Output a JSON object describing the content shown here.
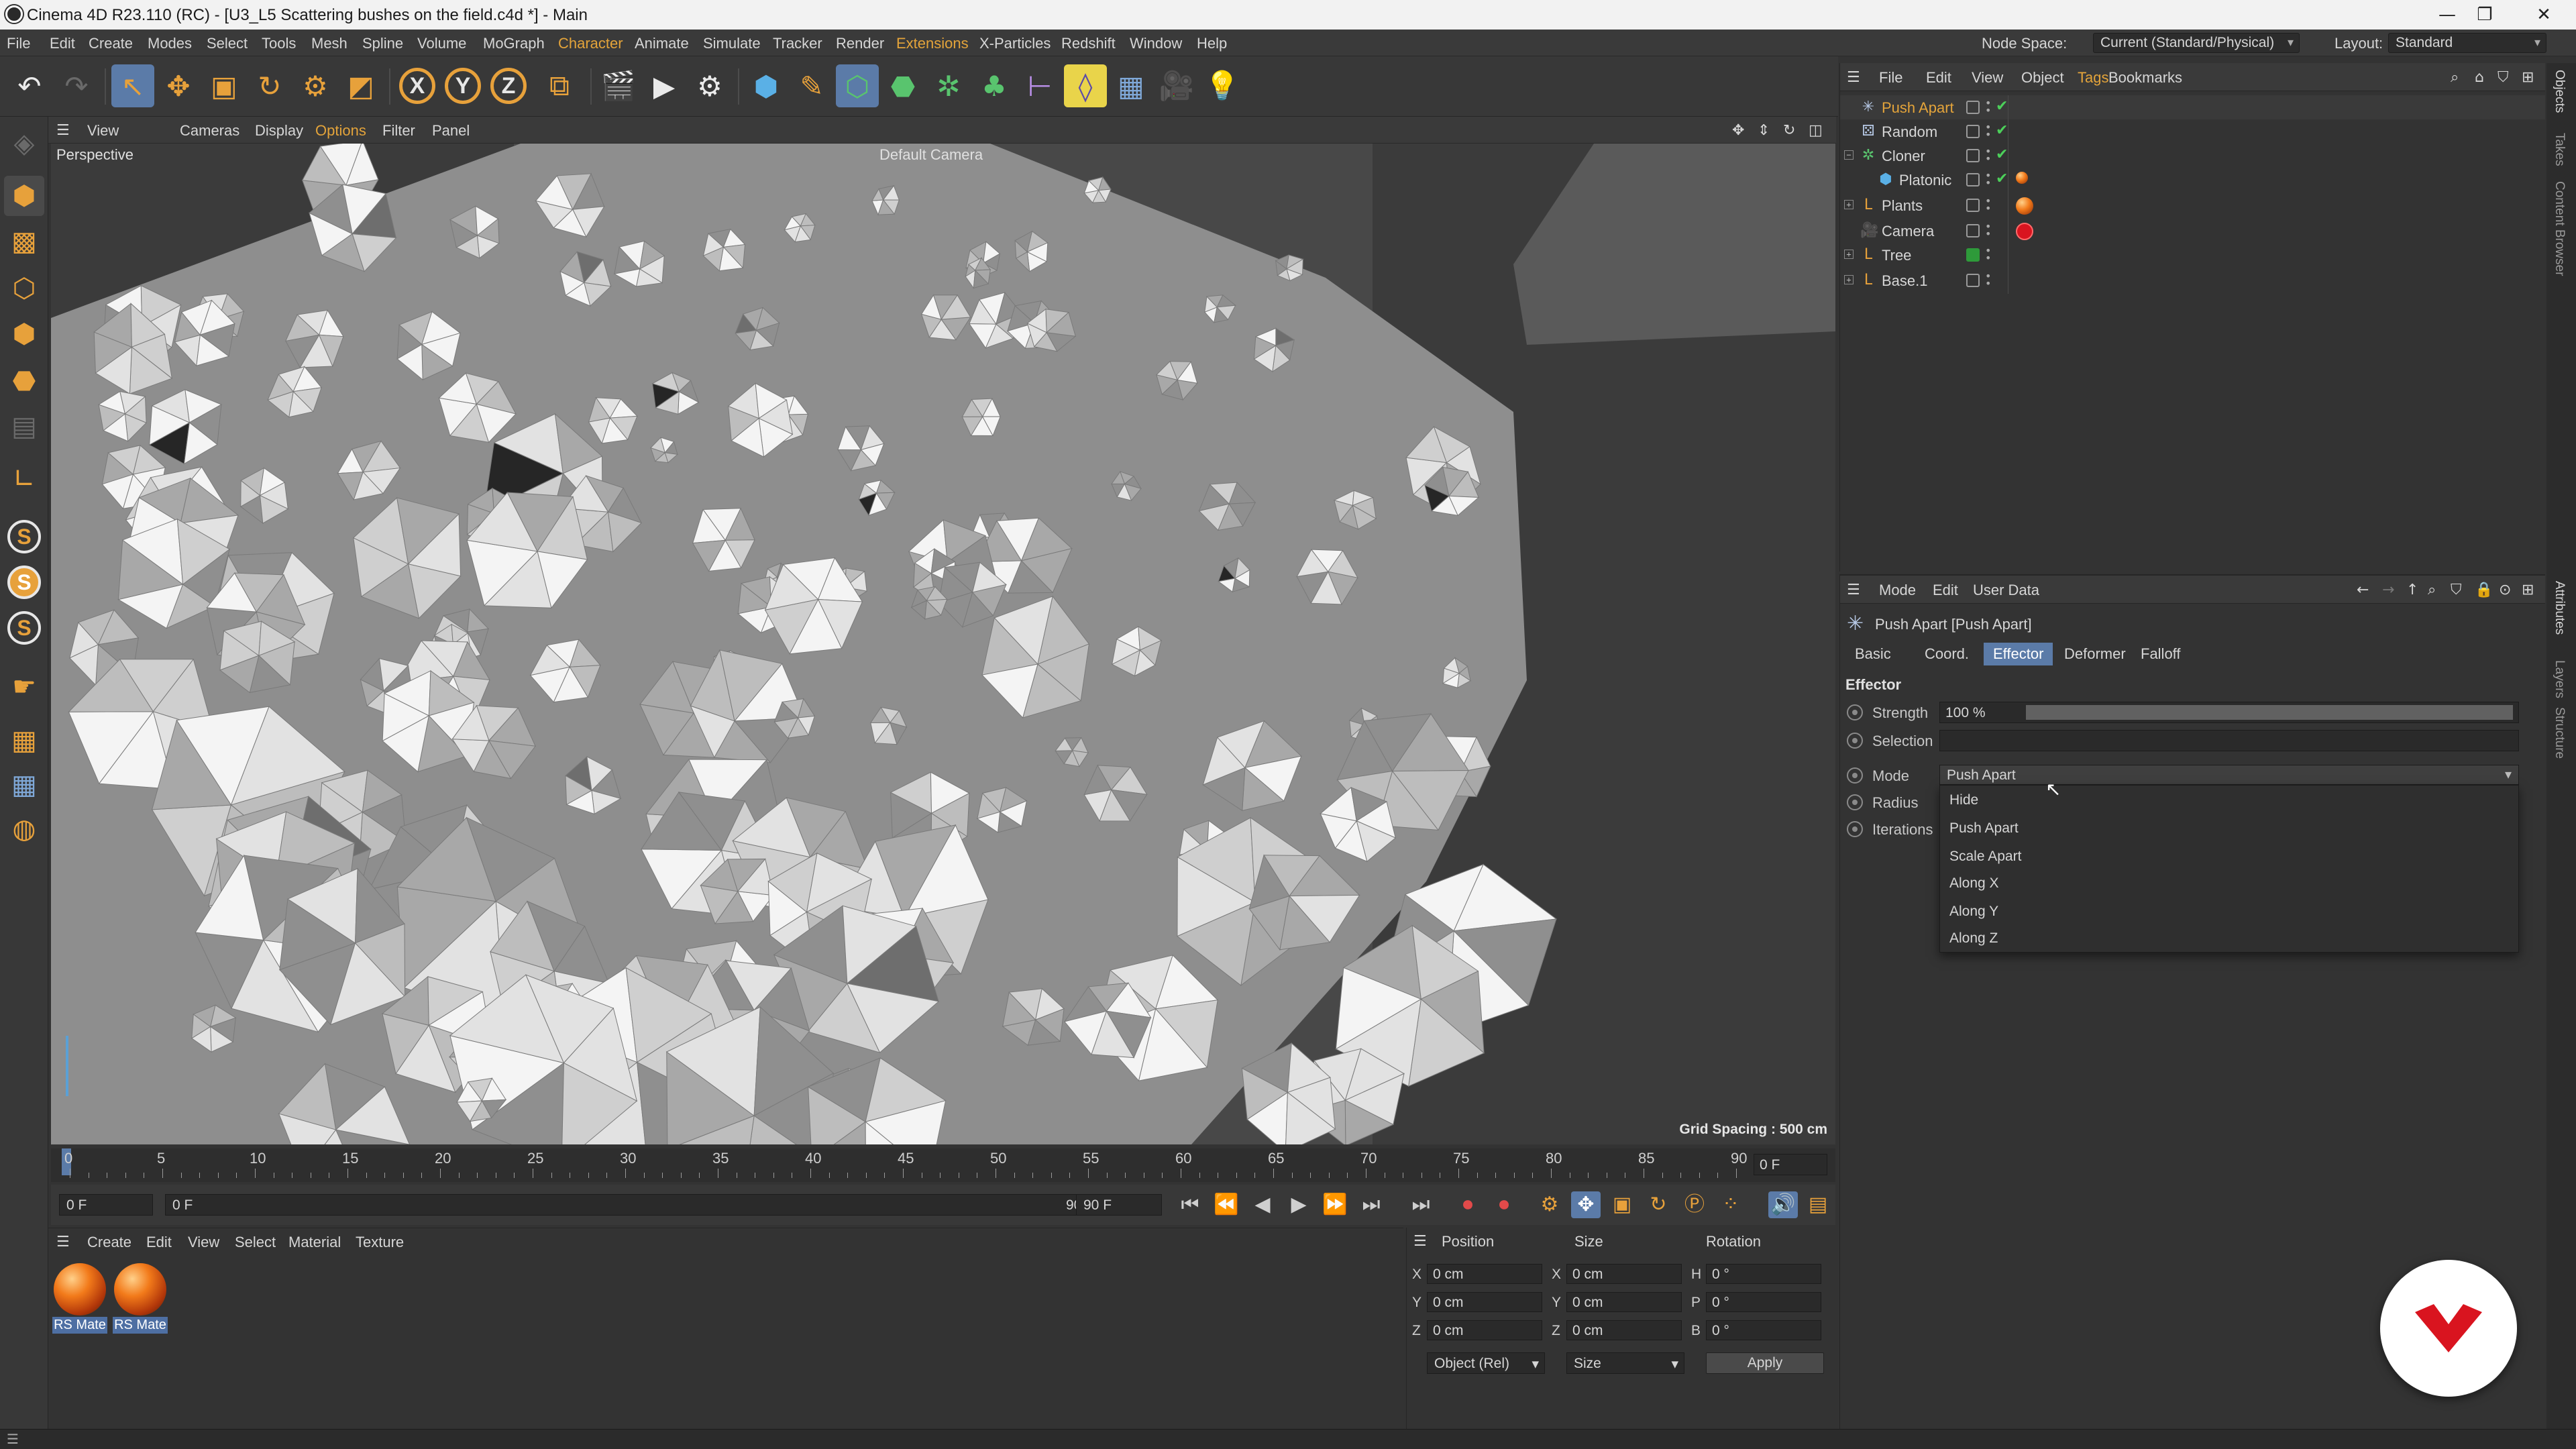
{
  "window": {
    "title": "Cinema 4D R23.110 (RC) - [U3_L5 Scattering bushes on the field.c4d *] - Main",
    "minimize_glyph": "—",
    "maximize_glyph": "❐",
    "close_glyph": "✕"
  },
  "menubar": {
    "items": [
      "File",
      "Edit",
      "Create",
      "Modes",
      "Select",
      "Tools",
      "Mesh",
      "Spline",
      "Volume",
      "MoGraph",
      "Character",
      "Animate",
      "Simulate",
      "Tracker",
      "Render",
      "Extensions",
      "X-Particles",
      "Redshift",
      "Window",
      "Help"
    ],
    "highlighted": [
      "Character",
      "Extensions"
    ],
    "node_space_label": "Node Space:",
    "node_space_value": "Current (Standard/Physical)",
    "layout_label": "Layout:",
    "layout_value": "Standard"
  },
  "toolbar": {
    "x_label": "X",
    "y_label": "Y",
    "z_label": "Z",
    "accent": "#e7a13b",
    "active_color": "#5b7ba8"
  },
  "left_toolbar": {
    "s_labels": [
      "S",
      "S",
      "S"
    ]
  },
  "viewport": {
    "menus": [
      "View",
      "Cameras",
      "Display",
      "Options",
      "Filter",
      "Panel"
    ],
    "highlighted_menu": "Options",
    "view_name": "Perspective",
    "camera_name": "Default Camera",
    "grid_spacing": "Grid Spacing : 500 cm"
  },
  "timeline": {
    "ticks": [
      0,
      5,
      10,
      15,
      20,
      25,
      30,
      35,
      40,
      45,
      50,
      55,
      60,
      65,
      70,
      75,
      80,
      85,
      90
    ],
    "current_frame_right": "0 F"
  },
  "transport": {
    "start_frame": "0 F",
    "range_start": "0 F",
    "range_end": "90 F",
    "end_frame": "90 F"
  },
  "material_manager": {
    "menus": [
      "Create",
      "Edit",
      "View",
      "Select",
      "Material",
      "Texture"
    ],
    "materials": [
      {
        "name": "RS Mate"
      },
      {
        "name": "RS Mate"
      }
    ]
  },
  "coordinates": {
    "headers": {
      "position": "Position",
      "size": "Size",
      "rotation": "Rotation"
    },
    "rows": [
      {
        "axis": "X",
        "pos": "0 cm",
        "size_axis": "X",
        "size": "0 cm",
        "rot_axis": "H",
        "rot": "0 °"
      },
      {
        "axis": "Y",
        "pos": "0 cm",
        "size_axis": "Y",
        "size": "0 cm",
        "rot_axis": "P",
        "rot": "0 °"
      },
      {
        "axis": "Z",
        "pos": "0 cm",
        "size_axis": "Z",
        "size": "0 cm",
        "rot_axis": "B",
        "rot": "0 °"
      }
    ],
    "mode_dropdown": "Object (Rel)",
    "size_dropdown": "Size",
    "apply_label": "Apply"
  },
  "objects_manager": {
    "menus": [
      "File",
      "Edit",
      "View",
      "Object",
      "Tags",
      "Bookmarks"
    ],
    "highlighted_menu": "Tags",
    "objects": [
      {
        "name": "Push Apart",
        "selected": true
      },
      {
        "name": "Random",
        "selected": false
      },
      {
        "name": "Cloner",
        "selected": false
      },
      {
        "name": "Platonic",
        "selected": false
      },
      {
        "name": "Plants",
        "selected": false
      },
      {
        "name": "Camera",
        "selected": false
      },
      {
        "name": "Tree",
        "selected": false
      },
      {
        "name": "Base.1",
        "selected": false
      }
    ]
  },
  "attributes_manager": {
    "menus": [
      "Mode",
      "Edit",
      "User Data"
    ],
    "object_title": "Push Apart [Push Apart]",
    "tabs": [
      "Basic",
      "Coord.",
      "Effector",
      "Deformer",
      "Falloff"
    ],
    "active_tab": "Effector",
    "section_title": "Effector",
    "strength_label": "Strength",
    "strength_value": "100 %",
    "strength_fraction": 1.0,
    "selection_label": "Selection",
    "mode_label": "Mode",
    "mode_value": "Push Apart",
    "radius_label": "Radius",
    "iterations_label": "Iterations",
    "mode_options": [
      "Hide",
      "Push Apart",
      "Scale Apart",
      "Along X",
      "Along Y",
      "Along Z"
    ]
  },
  "right_tabs": [
    "Objects",
    "Takes",
    "Content Browser",
    "Attributes",
    "Layers",
    "Structure"
  ],
  "colors": {
    "accent_orange": "#e4a43a",
    "selection_blue": "#5b7ba8",
    "check_green": "#4ccf5a",
    "logo_red": "#d9141f"
  }
}
